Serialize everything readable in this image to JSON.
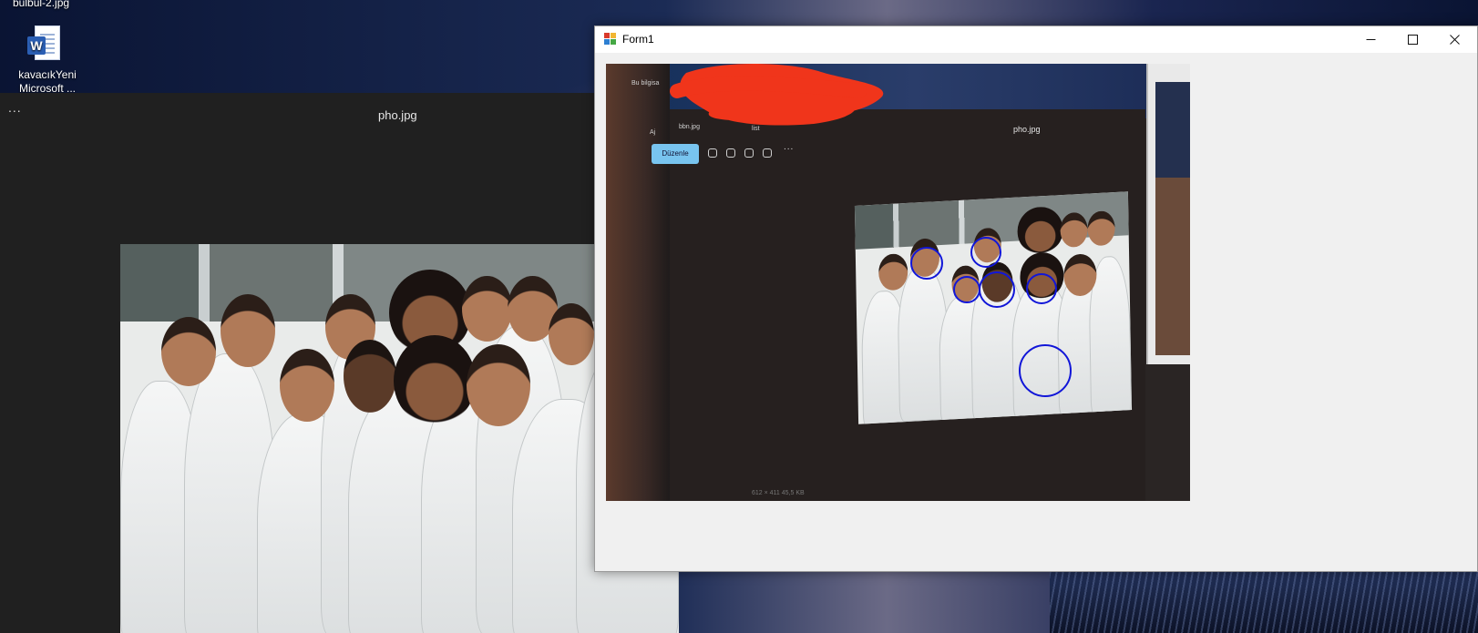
{
  "desktop": {
    "file_top_label": "bulbul-2.jpg",
    "word_file_name": "kavacıkYeni Microsoft ...",
    "word_badge": "W"
  },
  "viewer": {
    "title": "pho.jpg",
    "more_label": "..."
  },
  "form": {
    "title": "Form1",
    "controls": [
      "minimize",
      "maximize",
      "close"
    ]
  },
  "captured": {
    "edit_label": "Düzenle",
    "viewer_title": "pho.jpg",
    "desktop_labels": [
      "Bu bilgisa",
      "Aj",
      "bbn.jpg",
      "list"
    ],
    "more_label": "...",
    "status": "612 × 411   45,5 KB"
  },
  "colors": {
    "detection_circle": "#1116d8",
    "redaction": "#f0351b"
  }
}
